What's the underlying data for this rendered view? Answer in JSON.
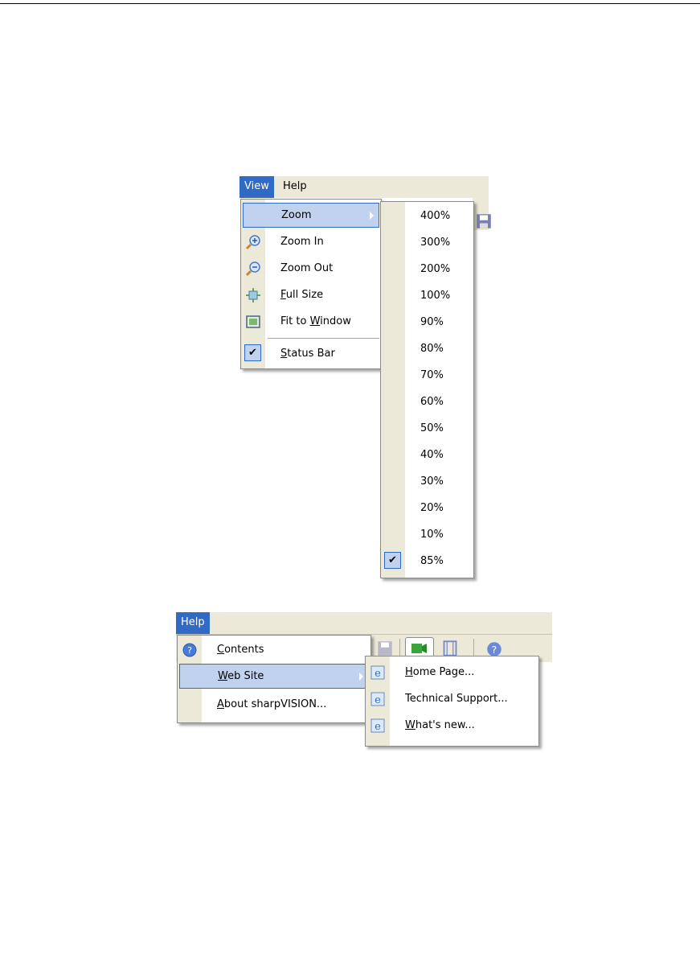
{
  "view_menu_shot": {
    "menubar": {
      "view_label": "View",
      "help_label": "Help"
    },
    "view_menu": {
      "items": [
        {
          "label": "Zoom",
          "icon": "none",
          "has_submenu": true,
          "highlighted": true
        },
        {
          "label": "Zoom In",
          "icon": "zoom-in-icon"
        },
        {
          "label": "Zoom Out",
          "icon": "zoom-out-icon"
        },
        {
          "label": "Full Size",
          "mnemonic": "F",
          "icon": "full-size-icon"
        },
        {
          "label": "Fit to Window",
          "mnemonic": "W",
          "icon": "fit-window-icon"
        },
        {
          "label": "Status Bar",
          "mnemonic": "S",
          "icon": "check-icon",
          "checked": true
        }
      ],
      "full_size_rest": "ull Size",
      "full_size_first": "F",
      "fit_prefix": "Fit to ",
      "fit_first": "W",
      "fit_rest": "indow",
      "status_first": "S",
      "status_rest": "tatus Bar"
    },
    "zoom_submenu": {
      "items": [
        "400%",
        "300%",
        "200%",
        "100%",
        "90%",
        "80%",
        "70%",
        "60%",
        "50%",
        "40%",
        "30%",
        "20%",
        "10%",
        "85%"
      ],
      "checked": "85%"
    }
  },
  "help_menu_shot": {
    "menubar": {
      "help_label": "Help"
    },
    "help_menu": {
      "contents_first": "C",
      "contents_rest": "ontents",
      "website_first": "W",
      "website_rest": "eb Site",
      "about_first": "A",
      "about_rest": "bout sharpVISION..."
    },
    "website_submenu": {
      "home_first": "H",
      "home_rest": "ome Page...",
      "tech_label": "Technical Support...",
      "whats_first": "W",
      "whats_rest": "hat's new..."
    }
  },
  "colors": {
    "menu_bg": "#ece9d8",
    "highlight": "#c1d2ee",
    "highlight_border": "#316ac5",
    "active_title": "#316ac5"
  }
}
